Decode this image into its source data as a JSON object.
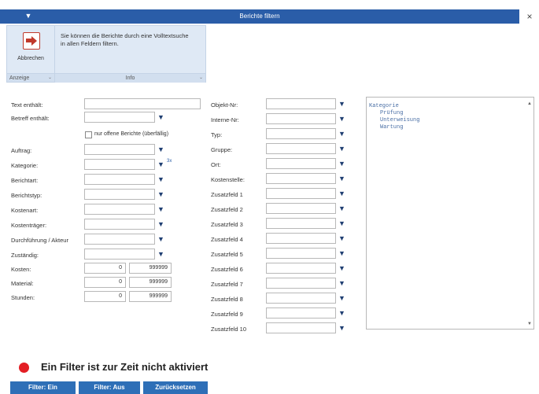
{
  "window": {
    "title": "Berichte filtern",
    "qa_icon": "▼",
    "close": "×"
  },
  "ribbon": {
    "cancel_label": "Abbrechen",
    "info_text": "Sie können die Berichte durch eine Volltextsuche in allen Feldern filtern.",
    "group_anzeige": "Anzeige",
    "group_info": "Info"
  },
  "left_fields": {
    "text_label": "Text enthält:",
    "betreff_label": "Betreff enthält:",
    "offene_label": "nur offene Berichte (überfällig)",
    "auftrag_label": "Auftrag:",
    "kategorie_label": "Kategorie:",
    "berichtart_label": "Berichtart:",
    "berichtstyp_label": "Berichtstyp:",
    "kostenart_label": "Kostenart:",
    "kostentraeger_label": "Kostenträger:",
    "durchfuehrung_label": "Durchführung / Akteur",
    "zustaendig_label": "Zuständig:",
    "kosten_label": "Kosten:",
    "material_label": "Material:",
    "stunden_label": "Stunden:",
    "kosten_from": "0",
    "kosten_to": "999999",
    "material_from": "0",
    "material_to": "999999",
    "stunden_from": "0",
    "stunden_to": "999999",
    "kategorie_extra": "3x"
  },
  "mid_fields": [
    "Objekt-Nr:",
    "Interne-Nr:",
    "Typ:",
    "Gruppe:",
    "Ort:",
    "Kostenstelle:",
    "Zusatzfeld 1",
    "Zusatzfeld 2",
    "Zusatzfeld 3",
    "Zusatzfeld 4",
    "Zusatzfeld 5",
    "Zusatzfeld 6",
    "Zusatzfeld 7",
    "Zusatzfeld 8",
    "Zusatzfeld 9",
    "Zusatzfeld 10"
  ],
  "tree": {
    "root": "Kategorie",
    "items": [
      "Prüfung",
      "Unterweisung",
      "Wartung"
    ]
  },
  "status": {
    "text": "Ein Filter ist zur Zeit nicht aktiviert",
    "color": "#e31e24"
  },
  "buttons": {
    "filter_on": "Filter: Ein",
    "filter_off": "Filter: Aus",
    "reset": "Zurücksetzen"
  },
  "icons": {
    "dropdown": "▼",
    "scroll_up": "▲",
    "scroll_down": "▼",
    "group_expand": "⌄"
  },
  "colors": {
    "titlebar": "#2a5da8",
    "ribbon": "#dfe9f5",
    "button": "#2e6fb7"
  }
}
